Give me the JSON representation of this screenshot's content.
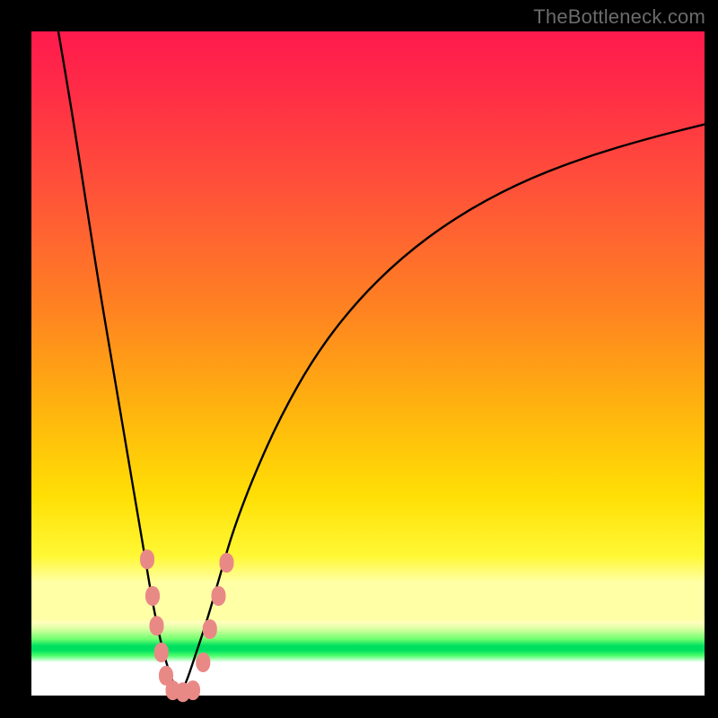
{
  "watermark": "TheBottleneck.com",
  "chart_data": {
    "type": "line",
    "title": "",
    "xlabel": "",
    "ylabel": "",
    "xlim": [
      0,
      100
    ],
    "ylim": [
      0,
      100
    ],
    "grid": false,
    "series": [
      {
        "name": "bottleneck-curve",
        "x": [
          4,
          6,
          8,
          10,
          12,
          14,
          16,
          17,
          18,
          19,
          20,
          21,
          22,
          23,
          24,
          26,
          28,
          30,
          33,
          37,
          42,
          48,
          55,
          63,
          72,
          82,
          92,
          100
        ],
        "y": [
          100,
          88,
          75,
          62,
          50,
          38,
          26,
          20,
          14,
          9,
          5,
          2,
          0,
          2,
          5,
          11,
          18,
          25,
          33,
          42,
          51,
          59,
          66,
          72,
          77,
          81,
          84,
          86
        ]
      }
    ],
    "markers": {
      "name": "highlight-dots",
      "color": "#e98986",
      "points": [
        {
          "x": 17.2,
          "y": 20.5
        },
        {
          "x": 18.0,
          "y": 15.0
        },
        {
          "x": 18.6,
          "y": 10.5
        },
        {
          "x": 19.3,
          "y": 6.5
        },
        {
          "x": 20.0,
          "y": 3.0
        },
        {
          "x": 21.0,
          "y": 0.8
        },
        {
          "x": 22.5,
          "y": 0.5
        },
        {
          "x": 24.0,
          "y": 0.8
        },
        {
          "x": 25.5,
          "y": 5.0
        },
        {
          "x": 26.5,
          "y": 10.0
        },
        {
          "x": 27.8,
          "y": 15.0
        },
        {
          "x": 29.0,
          "y": 20.0
        }
      ]
    },
    "background_gradient": {
      "top": "#ff1a4d",
      "mid": "#ffdf05",
      "green_band": "#00e060",
      "bottom": "#ffffff"
    }
  }
}
